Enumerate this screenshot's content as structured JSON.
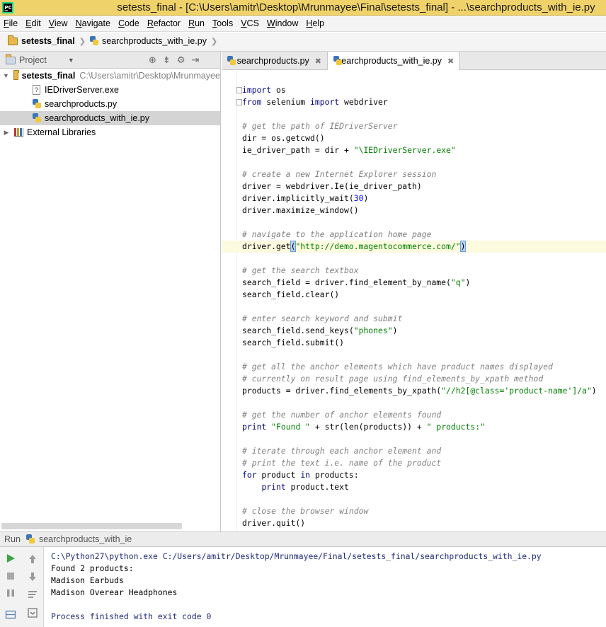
{
  "window": {
    "title": "setests_final - [C:\\Users\\amitr\\Desktop\\Mrunmayee\\Final\\setests_final] - ...\\searchproducts_with_ie.py"
  },
  "menu": [
    "File",
    "Edit",
    "View",
    "Navigate",
    "Code",
    "Refactor",
    "Run",
    "Tools",
    "VCS",
    "Window",
    "Help"
  ],
  "breadcrumb": {
    "project": "setests_final",
    "file": "searchproducts_with_ie.py"
  },
  "sidebar": {
    "header_label": "Project",
    "tree": [
      {
        "label": "setests_final",
        "path": "C:\\Users\\amitr\\Desktop\\Mrunmayee",
        "type": "folder"
      },
      {
        "label": "IEDriverServer.exe",
        "type": "exe"
      },
      {
        "label": "searchproducts.py",
        "type": "python"
      },
      {
        "label": "searchproducts_with_ie.py",
        "type": "python",
        "selected": true
      },
      {
        "label": "External Libraries",
        "type": "library"
      }
    ]
  },
  "editor": {
    "tabs": [
      {
        "label": "searchproducts.py",
        "active": false
      },
      {
        "label": "searchproducts_with_ie.py",
        "active": true
      }
    ],
    "code": [
      {
        "parts": [
          [
            "kw",
            "import"
          ],
          [
            "t",
            " os"
          ]
        ]
      },
      {
        "parts": [
          [
            "kw",
            "from"
          ],
          [
            "t",
            " selenium "
          ],
          [
            "kw",
            "import"
          ],
          [
            "t",
            " webdriver"
          ]
        ]
      },
      {
        "parts": []
      },
      {
        "parts": [
          [
            "cm",
            "# get the path of IEDriverServer"
          ]
        ]
      },
      {
        "parts": [
          [
            "t",
            "dir = os.getcwd()"
          ]
        ]
      },
      {
        "parts": [
          [
            "t",
            "ie_driver_path = dir + "
          ],
          [
            "str",
            "\"\\IEDriverServer.exe\""
          ]
        ]
      },
      {
        "parts": []
      },
      {
        "parts": [
          [
            "cm",
            "# create a new Internet Explorer session"
          ]
        ]
      },
      {
        "parts": [
          [
            "t",
            "driver = webdriver.Ie(ie_driver_path)"
          ]
        ]
      },
      {
        "parts": [
          [
            "t",
            "driver.implicitly_wait("
          ],
          [
            "num",
            "30"
          ],
          [
            "t",
            ")"
          ]
        ]
      },
      {
        "parts": [
          [
            "t",
            "driver.maximize_window()"
          ]
        ]
      },
      {
        "parts": []
      },
      {
        "parts": [
          [
            "cm",
            "# navigate to the application home page"
          ]
        ]
      },
      {
        "parts": [
          [
            "t",
            "driver.get"
          ],
          [
            "br",
            "("
          ],
          [
            "str",
            "\"http://demo.magentocommerce.com/\""
          ],
          [
            "br",
            ")"
          ]
        ],
        "highlight": true
      },
      {
        "parts": []
      },
      {
        "parts": [
          [
            "cm",
            "# get the search textbox"
          ]
        ]
      },
      {
        "parts": [
          [
            "t",
            "search_field = driver.find_element_by_name("
          ],
          [
            "str",
            "\"q\""
          ],
          [
            "t",
            ")"
          ]
        ]
      },
      {
        "parts": [
          [
            "t",
            "search_field.clear()"
          ]
        ]
      },
      {
        "parts": []
      },
      {
        "parts": [
          [
            "cm",
            "# enter search keyword and submit"
          ]
        ]
      },
      {
        "parts": [
          [
            "t",
            "search_field.send_keys("
          ],
          [
            "str",
            "\"phones\""
          ],
          [
            "t",
            ")"
          ]
        ]
      },
      {
        "parts": [
          [
            "t",
            "search_field.submit()"
          ]
        ]
      },
      {
        "parts": []
      },
      {
        "parts": [
          [
            "cm",
            "# get all the anchor elements which have product names displayed"
          ]
        ]
      },
      {
        "parts": [
          [
            "cm",
            "# currently on result page using find_elements_by_xpath method"
          ]
        ]
      },
      {
        "parts": [
          [
            "t",
            "products = driver.find_elements_by_xpath("
          ],
          [
            "str",
            "\"//h2[@class='product-name']/a\""
          ],
          [
            "t",
            ")"
          ]
        ]
      },
      {
        "parts": []
      },
      {
        "parts": [
          [
            "cm",
            "# get the number of anchor elements found"
          ]
        ]
      },
      {
        "parts": [
          [
            "kw",
            "print"
          ],
          [
            "t",
            " "
          ],
          [
            "str",
            "\"Found \""
          ],
          [
            "t",
            " + str(len(products)) + "
          ],
          [
            "str",
            "\" products:\""
          ]
        ]
      },
      {
        "parts": []
      },
      {
        "parts": [
          [
            "cm",
            "# iterate through each anchor element and"
          ]
        ]
      },
      {
        "parts": [
          [
            "cm",
            "# print the text i.e. name of the product"
          ]
        ]
      },
      {
        "parts": [
          [
            "kw",
            "for"
          ],
          [
            "t",
            " product "
          ],
          [
            "kw",
            "in"
          ],
          [
            "t",
            " products:"
          ]
        ]
      },
      {
        "parts": [
          [
            "t",
            "    "
          ],
          [
            "kw",
            "print"
          ],
          [
            "t",
            " product.text"
          ]
        ]
      },
      {
        "parts": []
      },
      {
        "parts": [
          [
            "cm",
            "# close the browser window"
          ]
        ]
      },
      {
        "parts": [
          [
            "t",
            "driver.quit()"
          ]
        ]
      }
    ]
  },
  "run": {
    "label": "Run",
    "config": "searchproducts_with_ie",
    "output": [
      {
        "text": "C:\\Python27\\python.exe C:/Users/amitr/Desktop/Mrunmayee/Final/setests_final/searchproducts_with_ie.py",
        "kind": "cmd"
      },
      {
        "text": "Found 2 products:",
        "kind": "out"
      },
      {
        "text": "Madison Earbuds",
        "kind": "out"
      },
      {
        "text": "Madison Overear Headphones",
        "kind": "out"
      },
      {
        "text": "",
        "kind": "out"
      },
      {
        "text": "Process finished with exit code 0",
        "kind": "done"
      }
    ]
  }
}
